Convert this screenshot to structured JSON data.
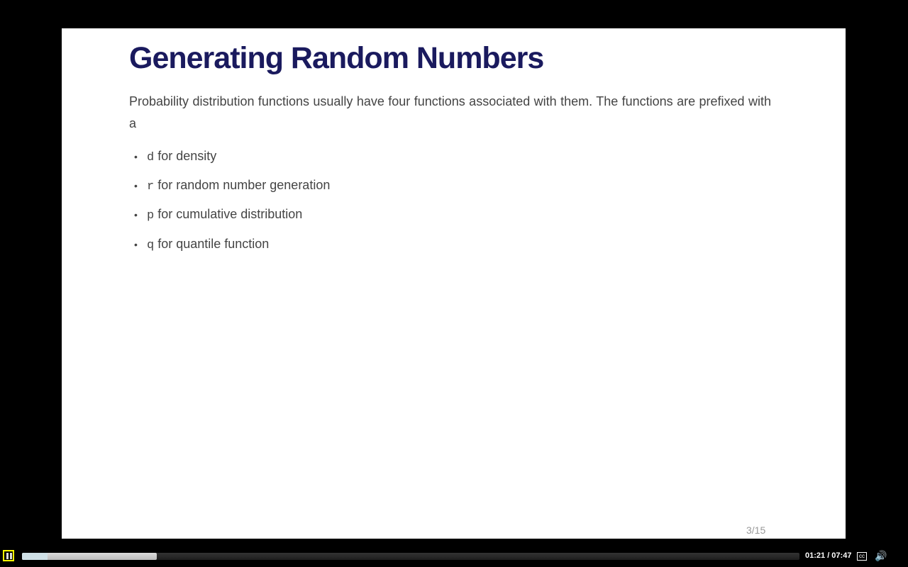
{
  "slide": {
    "title": "Generating Random Numbers",
    "intro": "Probability distribution functions usually have four functions associated with them. The functions are prefixed with a",
    "bullets": [
      {
        "code": "d",
        "text": "for density"
      },
      {
        "code": "r",
        "text": "for random number generation"
      },
      {
        "code": "p",
        "text": "for cumulative distribution"
      },
      {
        "code": "q",
        "text": "for quantile function"
      }
    ],
    "page": "3/15"
  },
  "player": {
    "time": "01:21 / 07:47",
    "progress": 0.173,
    "cc_label": "cc",
    "pause_icon": "pause-icon",
    "volume_icon": "volume-icon"
  }
}
